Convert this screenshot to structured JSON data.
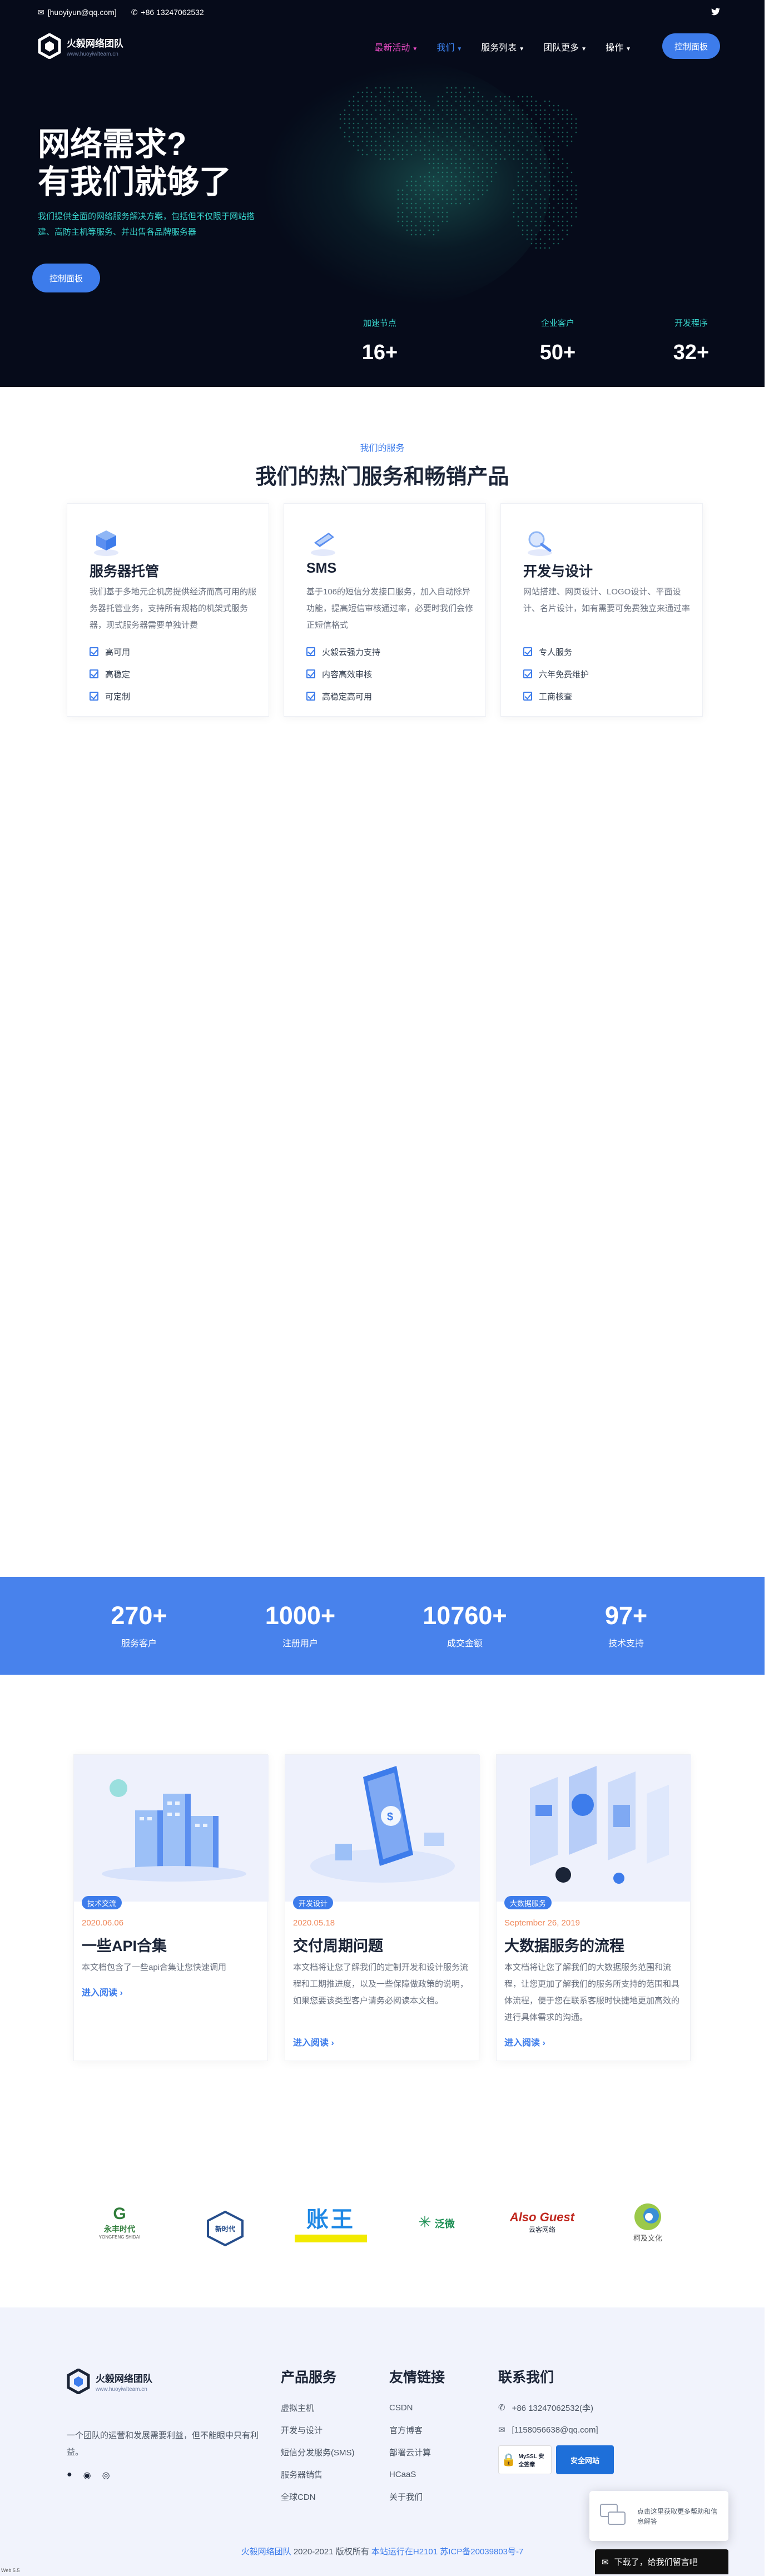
{
  "topbar": {
    "email": "[huoyiyun@qq.com]",
    "phone": "+86 13247062532"
  },
  "brand": {
    "name": "火毅网络团队",
    "sub": "www.huoyiwlteam.cn"
  },
  "nav": {
    "items": [
      "最新活动",
      "我们",
      "服务列表",
      "团队更多",
      "操作"
    ],
    "cta": "控制面板"
  },
  "hero": {
    "title_line1": "网络需求?",
    "title_line2": "有我们就够了",
    "desc": "我们提供全面的网络服务解决方案，包括但不仅限于网站搭建、高防主机等服务、并出售各品牌服务器",
    "button": "控制面板",
    "stats": [
      {
        "label": "加速节点",
        "value": "16+"
      },
      {
        "label": "企业客户",
        "value": "50+"
      },
      {
        "label": "开发程序",
        "value": "32+"
      }
    ]
  },
  "services": {
    "kicker": "我们的服务",
    "title": "我们的热门服务和畅销产品",
    "cards": [
      {
        "name": "服务器托管",
        "desc": "我们基于多地元企机房提供经济而高可用的服务器托管业务，支持所有规格的机架式服务器，现式服务器需要单独计费",
        "features": [
          "高可用",
          "高稳定",
          "可定制"
        ]
      },
      {
        "name": "SMS",
        "desc": "基于106的短信分发接口服务，加入自动除异功能，提高短信审核通过率，必要时我们会修正短信格式",
        "features": [
          "火毅云强力支持",
          "内容高效审核",
          "高稳定高可用"
        ]
      },
      {
        "name": "开发与设计",
        "desc": "网站搭建、网页设计、LOGO设计、平面设计、名片设计，如有需要可免费独立来通过率",
        "features": [
          "专人服务",
          "六年免费维护",
          "工商核查"
        ]
      }
    ]
  },
  "band": {
    "stats": [
      {
        "value": "270+",
        "label": "服务客户"
      },
      {
        "value": "1000+",
        "label": "注册用户"
      },
      {
        "value": "10760+",
        "label": "成交金额"
      },
      {
        "value": "97+",
        "label": "技术支持"
      }
    ]
  },
  "posts": [
    {
      "tag": "技术交流",
      "date": "2020.06.06",
      "title": "一些API合集",
      "body": "本文档包含了一些api合集让您快速调用",
      "more": "进入阅读 ›"
    },
    {
      "tag": "开发设计",
      "date": "2020.05.18",
      "title": "交付周期问题",
      "body": "本文档将让您了解我们的定制开发和设计服务流程和工期推进度，以及一些保障做政策的说明，如果您要该类型客户请务必阅读本文档。",
      "more": "进入阅读 ›"
    },
    {
      "tag": "大数据服务",
      "date": "September 26, 2019",
      "title": "大数据服务的流程",
      "body": "本文档将让您了解我们的大数据服务范围和流程，让您更加了解我们的服务所支持的范围和具体流程，便于您在联系客服时快捷地更加高效的进行具体需求的沟通。",
      "more": "进入阅读 ›"
    }
  ],
  "partners": [
    {
      "text": "永丰时代",
      "sub": "YONGFENG SHIDAI",
      "color": "#2f7d3a"
    },
    {
      "text": "新时代",
      "sub": "",
      "color": "#264e8c"
    },
    {
      "text": "账王",
      "sub": "",
      "color": "#1e88e5"
    },
    {
      "text": "泛微",
      "sub": "",
      "color": "#1d8f54"
    },
    {
      "text": "Also Guest",
      "sub": "云客网络",
      "color": "#c0271e"
    },
    {
      "text": "柯及文化",
      "sub": "",
      "color": "#444"
    }
  ],
  "footer": {
    "about": "一个团队的运营和发展需要利益，但不能眼中只有利益。",
    "col1": {
      "title": "产品服务",
      "items": [
        "虚拟主机",
        "开发与设计",
        "短信分发服务(SMS)",
        "服务器销售",
        "全球CDN"
      ]
    },
    "col2": {
      "title": "友情链接",
      "items": [
        "CSDN",
        "官方博客",
        "部署云计算",
        "HCaaS",
        "关于我们"
      ]
    },
    "col3": {
      "title": "联系我们",
      "items": [
        "+86 13247062532(李)",
        "[1158056638@qq.com]"
      ]
    },
    "badge1": "MySSL 安全签章",
    "badge2": "安全网站",
    "copyright_name": "火毅网络团队",
    "copyright_rest": "2020-2021 版权所有",
    "copyright_icp": "本站运行在H2101 苏ICP备20039803号-7"
  },
  "chat": {
    "text": "点击这里获取更多帮助和信息解答",
    "bar": "下载了，给我们留言吧"
  },
  "corner": "Web 5.5",
  "colors": {
    "accent": "#3d7ceb",
    "hero_bg": "#060b1a",
    "teal": "#38d4cc",
    "pink": "#e64bc3"
  }
}
